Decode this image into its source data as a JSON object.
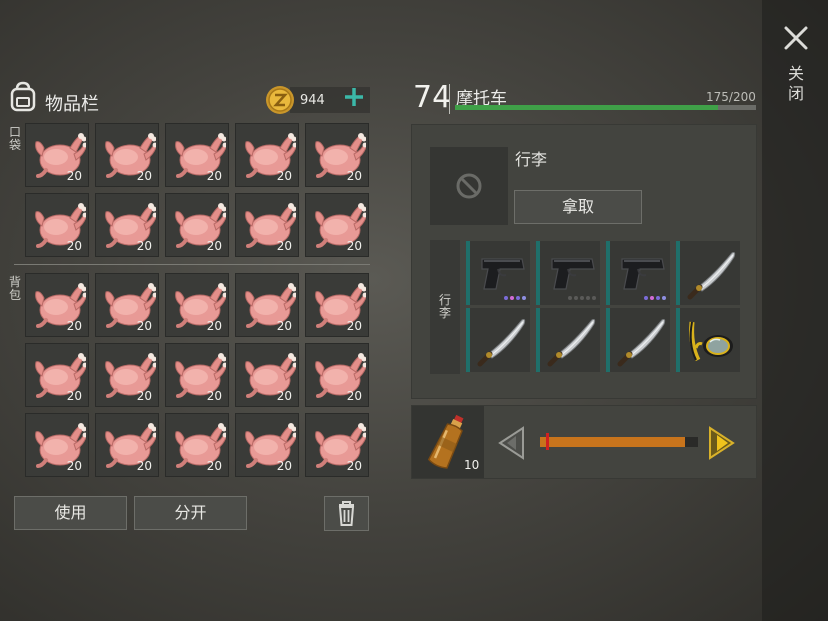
{
  "close": {
    "label": "关闭",
    "icon": "close-icon"
  },
  "inventory": {
    "title": "物品栏",
    "coins": "944",
    "pocket_label": "口袋",
    "backpack_label": "背包",
    "item_icon": "roast-chicken-icon",
    "pocket_counts": [
      "20",
      "20",
      "20",
      "20",
      "20",
      "20",
      "20",
      "20",
      "20",
      "20"
    ],
    "backpack_counts": [
      "20",
      "20",
      "20",
      "20",
      "20",
      "20",
      "20",
      "20",
      "20",
      "20",
      "20",
      "20",
      "20",
      "20",
      "20"
    ],
    "use_label": "使用",
    "split_label": "分开"
  },
  "vehicle": {
    "level": "74",
    "name": "摩托车",
    "capacity": "175/200",
    "durability_fraction": 0.875,
    "durability_color": "#3fa048"
  },
  "luggage": {
    "title": "行李",
    "take_label": "拿取",
    "side_label": "行李",
    "items": [
      {
        "icon": "pistol-icon",
        "dots": [
          "#7b6cd9",
          "#d36bd6",
          "#7b6cd9",
          "#8e8fe0"
        ]
      },
      {
        "icon": "pistol-icon",
        "dots": [
          "#5a5a58",
          "#5a5a58",
          "#5a5a58",
          "#5a5a58",
          "#5a5a58"
        ]
      },
      {
        "icon": "pistol-icon",
        "dots": [
          "#7b6cd9",
          "#d36bd6",
          "#7b6cd9",
          "#8e8fe0"
        ]
      },
      {
        "icon": "machete-icon",
        "dots": []
      },
      {
        "icon": "machete-icon",
        "dots": []
      },
      {
        "icon": "machete-icon",
        "dots": []
      },
      {
        "icon": "machete-icon",
        "dots": []
      },
      {
        "icon": "diving-goggles-icon",
        "dots": []
      }
    ]
  },
  "fuel": {
    "icon": "fuel-bottle-icon",
    "count": "10",
    "amount_fraction": 0.92,
    "fill_color": "#c8741c"
  }
}
